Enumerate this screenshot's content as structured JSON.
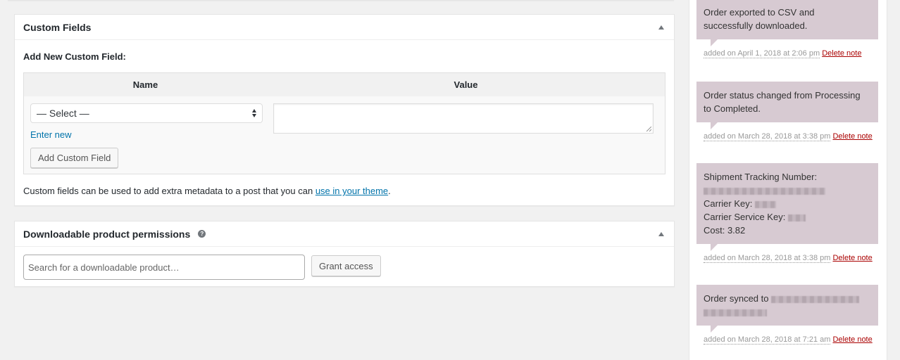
{
  "custom_fields": {
    "title": "Custom Fields",
    "add_new_label": "Add New Custom Field:",
    "columns": [
      "Name",
      "Value"
    ],
    "name_select": {
      "selected": "— Select —"
    },
    "value_textarea": {
      "value": ""
    },
    "enter_new_link": "Enter new",
    "add_button": "Add Custom Field",
    "description_prefix": "Custom fields can be used to add extra metadata to a post that you can ",
    "description_link": "use in your theme",
    "description_suffix": "."
  },
  "downloadable_permissions": {
    "title": "Downloadable product permissions",
    "help_icon": "?",
    "search_placeholder": "Search for a downloadable product…",
    "grant_button": "Grant access"
  },
  "order_notes": [
    {
      "lines": [
        "Order exported to CSV and",
        "successfully downloaded."
      ],
      "date": "added on April 1, 2018 at 2:06 pm",
      "delete_label": "Delete note"
    },
    {
      "lines": [
        "Order status changed from Processing",
        "to Completed."
      ],
      "date": "added on March 28, 2018 at 3:38 pm",
      "delete_label": "Delete note"
    },
    {
      "heading": "Shipment Tracking Number:",
      "carrier_key_label": "Carrier Key:",
      "carrier_service_key_label": "Carrier Service Key:",
      "cost_label": "Cost: 3.82",
      "date": "added on March 28, 2018 at 3:38 pm",
      "delete_label": "Delete note"
    },
    {
      "prefix": "Order synced to",
      "date": "added on March 28, 2018 at 7:21 am",
      "delete_label": "Delete note"
    }
  ],
  "colors": {
    "note_background": "#d7cad2",
    "link": "#0073aa",
    "delete_link": "#a00"
  }
}
